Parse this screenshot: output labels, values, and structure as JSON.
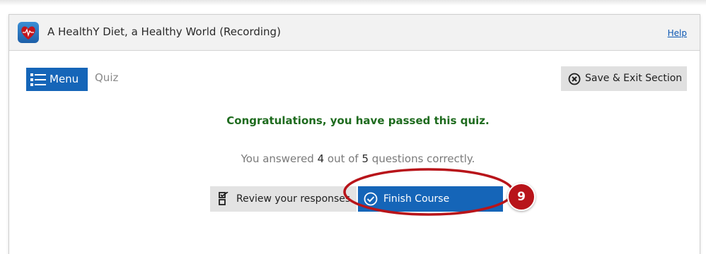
{
  "window": {
    "title": "A HealthY Diet, a Healthy World (Recording)",
    "help_link": "Help",
    "app_icon": "heart-icon"
  },
  "toolbar": {
    "menu_label": "Menu",
    "menu_icon": "list-icon",
    "section_title": "Quiz",
    "save_exit_label": "Save & Exit Section",
    "save_exit_icon": "close-circle-icon"
  },
  "result": {
    "congrats_message": "Congratulations, you have passed this quiz.",
    "score_prefix": "You answered ",
    "score_correct": "4",
    "score_middle": " out of ",
    "score_total": "5",
    "score_suffix": " questions correctly."
  },
  "actions": {
    "review_label": "Review your responses",
    "review_icon": "checklist-icon",
    "finish_label": "Finish Course",
    "finish_icon": "check-circle-icon"
  },
  "annotation": {
    "step_number": "9",
    "color": "#b8141a"
  },
  "colors": {
    "accent": "#1565b8",
    "success_text": "#1e6b1e"
  }
}
